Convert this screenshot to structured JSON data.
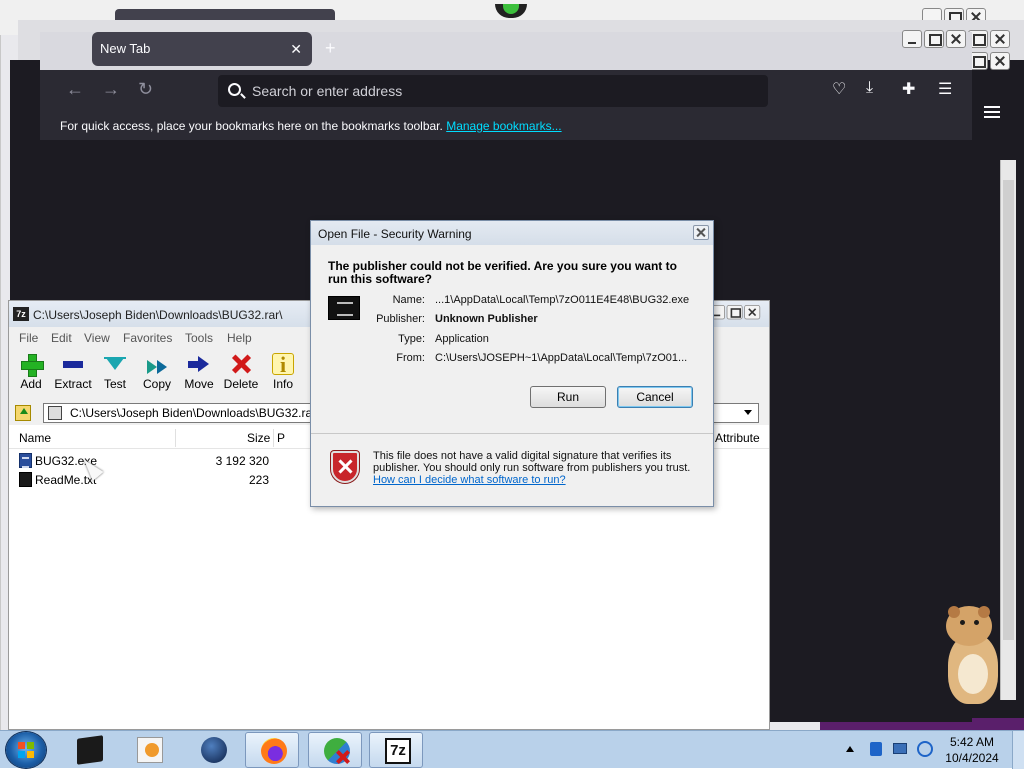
{
  "firefox": {
    "tab_title": "New Tab",
    "tab_close": "✕",
    "new_tab": "+",
    "url_placeholder": "Search or enter address",
    "bookmarks_message": "For quick access, place your bookmarks here on the bookmarks toolbar.",
    "bookmarks_link": "Manage bookmarks..."
  },
  "sevenzip": {
    "title": "C:\\Users\\Joseph Biden\\Downloads\\BUG32.rar\\",
    "app_icon_text": "7z",
    "menu": [
      "File",
      "Edit",
      "View",
      "Favorites",
      "Tools",
      "Help"
    ],
    "toolbar": [
      {
        "label": "Add",
        "icon": "add-icon"
      },
      {
        "label": "Extract",
        "icon": "extract-icon"
      },
      {
        "label": "Test",
        "icon": "test-icon"
      },
      {
        "label": "Copy",
        "icon": "copy-icon"
      },
      {
        "label": "Move",
        "icon": "move-icon"
      },
      {
        "label": "Delete",
        "icon": "delete-icon"
      },
      {
        "label": "Info",
        "icon": "info-icon"
      }
    ],
    "info_glyph": "i",
    "address": "C:\\Users\\Joseph Biden\\Downloads\\BUG32.rar\\",
    "columns": {
      "name": "Name",
      "size": "Size",
      "packed": "P",
      "attributes": "Attribute"
    },
    "files": [
      {
        "name": "BUG32.exe",
        "size": "3 192 320"
      },
      {
        "name": "ReadMe.txt",
        "size": "223"
      }
    ]
  },
  "dialog": {
    "title": "Open File - Security Warning",
    "question": "The publisher could not be verified.  Are you sure you want to run this software?",
    "fields": [
      {
        "label": "Name:",
        "value": "...1\\AppData\\Local\\Temp\\7zO011E4E48\\BUG32.exe"
      },
      {
        "label": "Publisher:",
        "value": "Unknown Publisher"
      },
      {
        "label": "Type:",
        "value": "Application"
      },
      {
        "label": "From:",
        "value": "C:\\Users\\JOSEPH~1\\AppData\\Local\\Temp\\7zO01..."
      }
    ],
    "run_button": "Run",
    "cancel_button": "Cancel",
    "note": "This file does not have a valid digital signature that verifies its publisher.  You should only run software from publishers you trust.",
    "help_link": "How can I decide what software to run?"
  },
  "taskbar": {
    "apps": [
      "terminal-icon",
      "media-player-icon",
      "globe-icon",
      "firefox-icon",
      "network-people-icon",
      "7zip-icon"
    ],
    "sevenzip_icon_text": "7z",
    "clock_time": "5:42 AM",
    "clock_date": "10/4/2024"
  },
  "colors": {
    "firefox_dark": "#1c1b22",
    "firefox_toolbar": "#2b2a33",
    "link_cyan": "#00ddff",
    "taskbar": "#b9d1ea",
    "dialog_bg": "#f0f0f0"
  }
}
